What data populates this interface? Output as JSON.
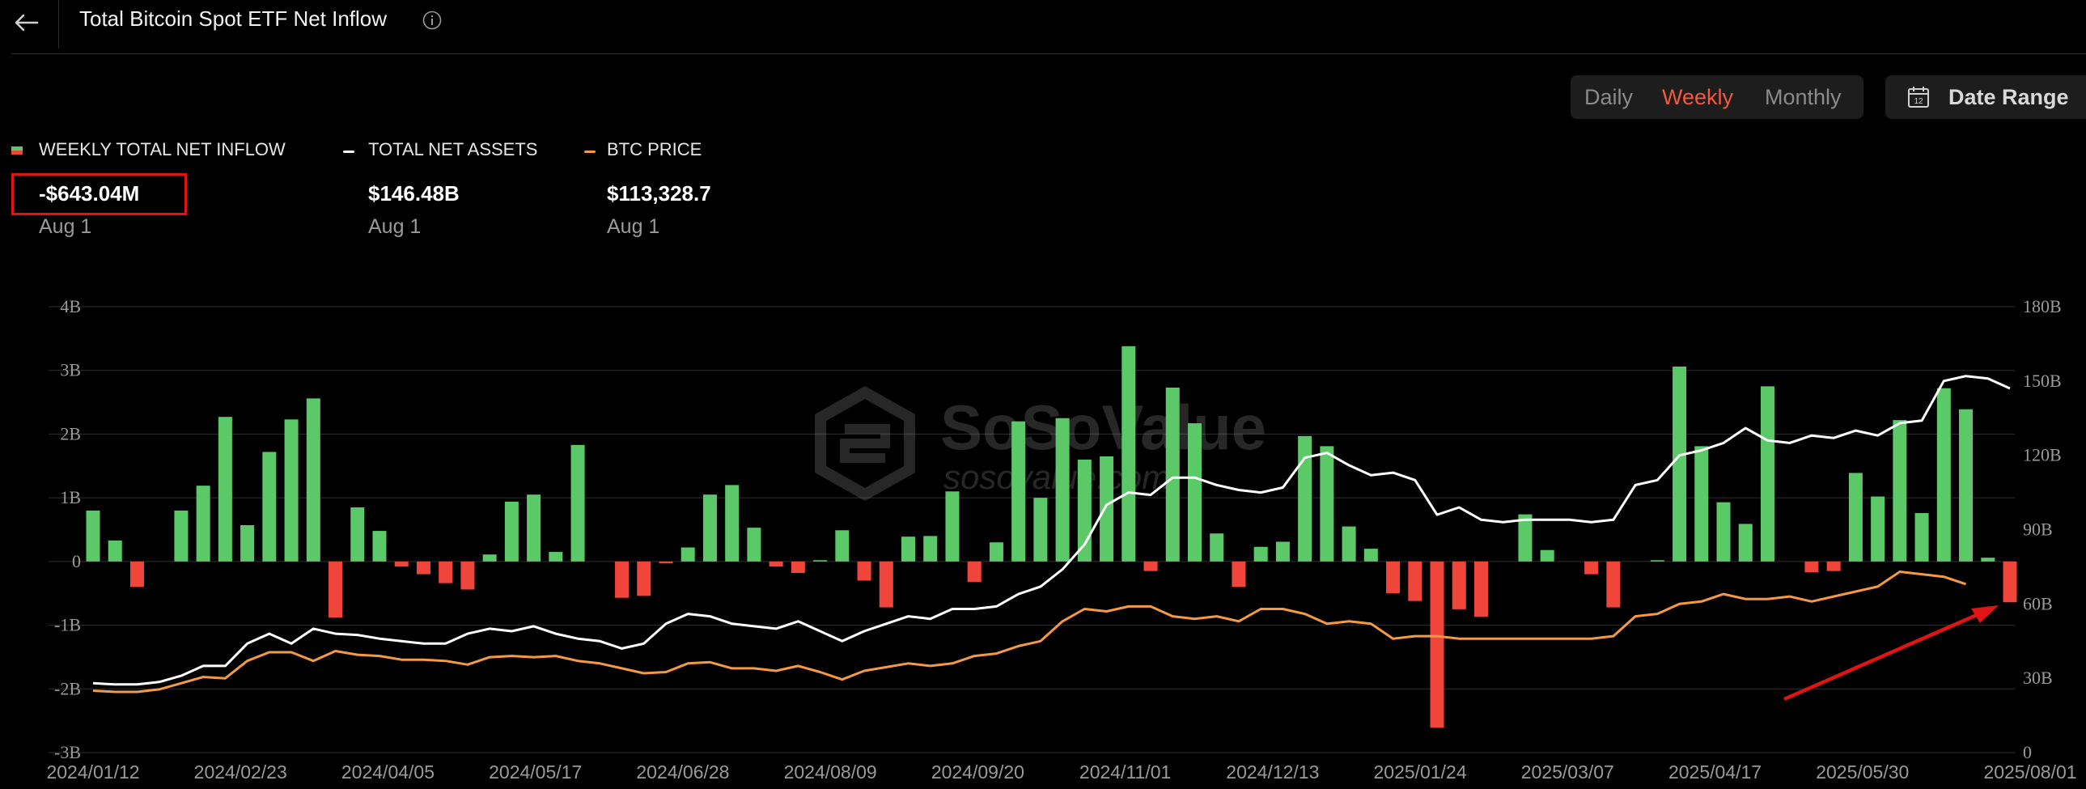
{
  "header": {
    "back_icon": "arrow-left-icon",
    "title": "Total Bitcoin Spot ETF Net Inflow",
    "info_icon": "info-circle-icon"
  },
  "period_tabs": [
    {
      "label": "Daily",
      "active": false
    },
    {
      "label": "Weekly",
      "active": true
    },
    {
      "label": "Monthly",
      "active": false
    }
  ],
  "date_range": {
    "icon": "calendar-icon",
    "label": "Date Range"
  },
  "legend": {
    "inflow": {
      "label": "WEEKLY TOTAL NET INFLOW",
      "value": "-$643.04M",
      "date": "Aug 1",
      "colors": [
        "#5cc969",
        "#f0453a"
      ]
    },
    "assets": {
      "label": "TOTAL NET ASSETS",
      "value": "$146.48B",
      "date": "Aug 1",
      "color": "#ffffff"
    },
    "price": {
      "label": "BTC PRICE",
      "value": "$113,328.7",
      "date": "Aug 1",
      "color": "#f59a44"
    }
  },
  "colors": {
    "positive": "#5cc969",
    "negative": "#f0453a",
    "assets_line": "#ffffff",
    "price_line": "#f59a44",
    "highlight": "#e01414",
    "accent": "#f25a3b"
  },
  "watermark": {
    "brand": "SoSoValue",
    "url": "sosovalue.com"
  },
  "chart_data": {
    "type": "bar",
    "x_tick_labels": [
      "2024/01/12",
      "2024/02/23",
      "2024/04/05",
      "2024/05/17",
      "2024/06/28",
      "2024/08/09",
      "2024/09/20",
      "2024/11/01",
      "2024/12/13",
      "2025/01/24",
      "2025/03/07",
      "2025/04/17",
      "2025/05/30",
      "2025/08/01"
    ],
    "y_left": {
      "ticks": [
        "4B",
        "3B",
        "2B",
        "1B",
        "0",
        "-1B",
        "-2B",
        "-3B"
      ],
      "range": [
        -3,
        4
      ],
      "unit": "B USD"
    },
    "y_right": {
      "ticks": [
        "180B",
        "150B",
        "120B",
        "90B",
        "60B",
        "30B",
        "0"
      ],
      "range": [
        0,
        180
      ],
      "unit": "B"
    },
    "grid": true,
    "series": [
      {
        "name": "WEEKLY TOTAL NET INFLOW",
        "axis": "left",
        "type": "bar",
        "values": [
          0.8,
          0.33,
          -0.4,
          0,
          0.8,
          1.19,
          2.27,
          0.57,
          1.72,
          2.23,
          2.56,
          -0.88,
          0.85,
          0.48,
          -0.08,
          -0.2,
          -0.34,
          -0.44,
          0.11,
          0.94,
          1.05,
          0.15,
          1.83,
          0,
          -0.57,
          -0.54,
          -0.03,
          0.22,
          1.05,
          1.2,
          0.53,
          -0.08,
          -0.18,
          0.02,
          0.49,
          -0.3,
          -0.72,
          0.39,
          0.4,
          1.1,
          -0.32,
          0.3,
          2.2,
          1.0,
          2.25,
          1.6,
          1.65,
          3.38,
          -0.15,
          2.73,
          2.17,
          0.44,
          -0.4,
          0.23,
          0.31,
          1.97,
          1.81,
          0.55,
          0.2,
          -0.5,
          -0.62,
          -2.61,
          -0.75,
          -0.87,
          0,
          0.74,
          0.18,
          0,
          -0.2,
          -0.72,
          0,
          0.02,
          3.06,
          1.81,
          0.93,
          0.59,
          2.75,
          0,
          -0.17,
          -0.15,
          1.39,
          1.02,
          2.22,
          0.76,
          2.72,
          2.39,
          0.06,
          -0.64
        ]
      },
      {
        "name": "TOTAL NET ASSETS",
        "axis": "right",
        "type": "line",
        "values": [
          28,
          27.5,
          27.5,
          28.5,
          31,
          35,
          35,
          44,
          48,
          44,
          50,
          48,
          47.5,
          46,
          45,
          44,
          44,
          48,
          50,
          49,
          51,
          48,
          46,
          45,
          42,
          44,
          52,
          56,
          55,
          52,
          51,
          50,
          53,
          49,
          45,
          49,
          52,
          55,
          54,
          58,
          58,
          59,
          64,
          67,
          74,
          84,
          100,
          105,
          104,
          111,
          111,
          108,
          106,
          105,
          107,
          119,
          121,
          116,
          112,
          113,
          110,
          96,
          99,
          94,
          93,
          94,
          94,
          94,
          93,
          94,
          108,
          110,
          120,
          122,
          125,
          131,
          126,
          125,
          128,
          127,
          130,
          128,
          133,
          134,
          150,
          152,
          151,
          147
        ]
      },
      {
        "name": "BTC PRICE",
        "axis": "right",
        "type": "line",
        "values": [
          25,
          24.5,
          24.5,
          25.5,
          28,
          30.5,
          30,
          37,
          40.5,
          40.5,
          37,
          41,
          39.5,
          39,
          37.5,
          37.5,
          37,
          35.5,
          38.5,
          39,
          38.5,
          39,
          37,
          36,
          34,
          32,
          32.5,
          36,
          36.5,
          34,
          34,
          33,
          35,
          32.5,
          29.5,
          33,
          34.5,
          36,
          35,
          36,
          39,
          40,
          43,
          45,
          53,
          58,
          57,
          59,
          59,
          55,
          54,
          55,
          53,
          58,
          58,
          56,
          52,
          53,
          52,
          46,
          47,
          47,
          46,
          46,
          46,
          46,
          46,
          46,
          46,
          47,
          55,
          56,
          60,
          61,
          64,
          62,
          62,
          63,
          61,
          63,
          65,
          67,
          73,
          72,
          71,
          68
        ]
      }
    ],
    "last_point": {
      "date": "2025/08/01",
      "inflow": "-643.04M",
      "net_assets": "146.48B",
      "btc_price": "113,328.7"
    },
    "annotation": {
      "type": "arrow",
      "target": "last bar",
      "color": "#e01414"
    }
  }
}
